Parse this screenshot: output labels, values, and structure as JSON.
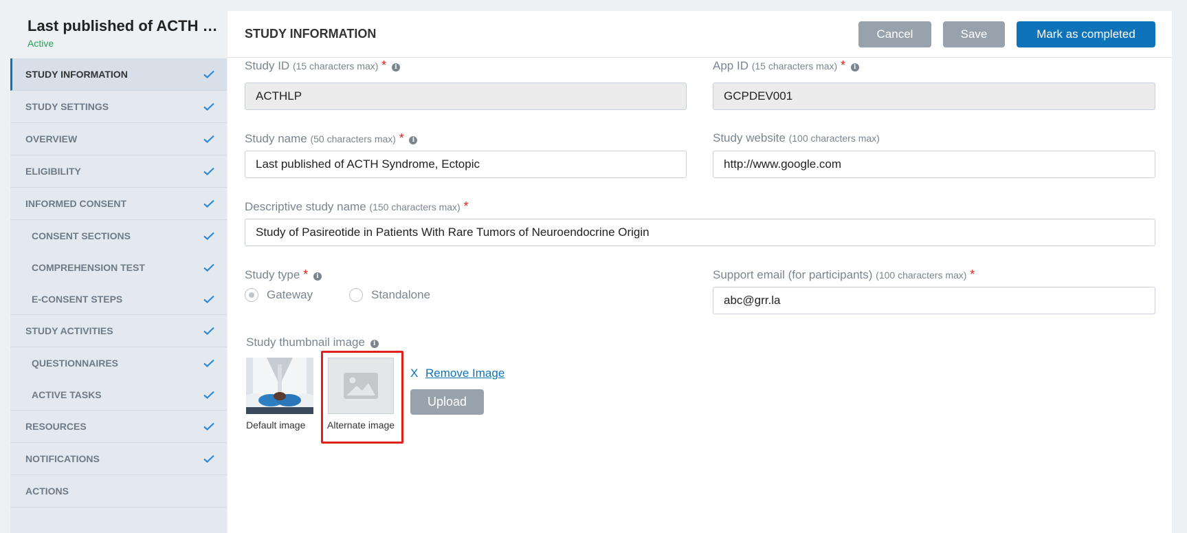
{
  "sidebar": {
    "study_title": "Last published of ACTH Syndrome, Ectopic",
    "status": "Active",
    "items": [
      {
        "label": "STUDY INFORMATION",
        "check": true
      },
      {
        "label": "STUDY SETTINGS",
        "check": true
      },
      {
        "label": "OVERVIEW",
        "check": true
      },
      {
        "label": "ELIGIBILITY",
        "check": true
      },
      {
        "label": "INFORMED CONSENT",
        "check": true
      },
      {
        "label": "CONSENT SECTIONS",
        "check": true
      },
      {
        "label": "COMPREHENSION TEST",
        "check": true
      },
      {
        "label": "E-CONSENT STEPS",
        "check": true
      },
      {
        "label": "STUDY ACTIVITIES",
        "check": true
      },
      {
        "label": "QUESTIONNAIRES",
        "check": true
      },
      {
        "label": "ACTIVE TASKS",
        "check": true
      },
      {
        "label": "RESOURCES",
        "check": true
      },
      {
        "label": "NOTIFICATIONS",
        "check": true
      },
      {
        "label": "ACTIONS",
        "check": false
      }
    ]
  },
  "header": {
    "title": "STUDY INFORMATION",
    "cancel": "Cancel",
    "save": "Save",
    "complete": "Mark as completed"
  },
  "form": {
    "study_id": {
      "label": "Study ID",
      "hint": "(15 characters max)",
      "value": "ACTHLP"
    },
    "app_id": {
      "label": "App ID",
      "hint": "(15 characters max)",
      "value": "GCPDEV001"
    },
    "study_name": {
      "label": "Study name",
      "hint": "(50 characters max)",
      "value": "Last published of ACTH Syndrome, Ectopic"
    },
    "study_website": {
      "label": "Study website",
      "hint": "(100 characters max)",
      "value": "http://www.google.com"
    },
    "descriptive_name": {
      "label": "Descriptive study name",
      "hint": "(150 characters max)",
      "value": "Study of Pasireotide in Patients With Rare Tumors of Neuroendocrine Origin"
    },
    "study_type": {
      "label": "Study type",
      "options": [
        "Gateway",
        "Standalone"
      ],
      "selected": "Gateway"
    },
    "support_email": {
      "label": "Support email (for participants)",
      "hint": "(100 characters max)",
      "value": "abc@grr.la"
    },
    "thumbnail": {
      "label": "Study thumbnail image",
      "default_caption": "Default image",
      "alternate_caption": "Alternate image",
      "remove_x": "X",
      "remove_label": "Remove Image",
      "upload": "Upload"
    }
  },
  "colors": {
    "accent": "#0f73b9",
    "active_green": "#29a35a",
    "required": "#e0211b",
    "highlight": "#e0211b"
  }
}
